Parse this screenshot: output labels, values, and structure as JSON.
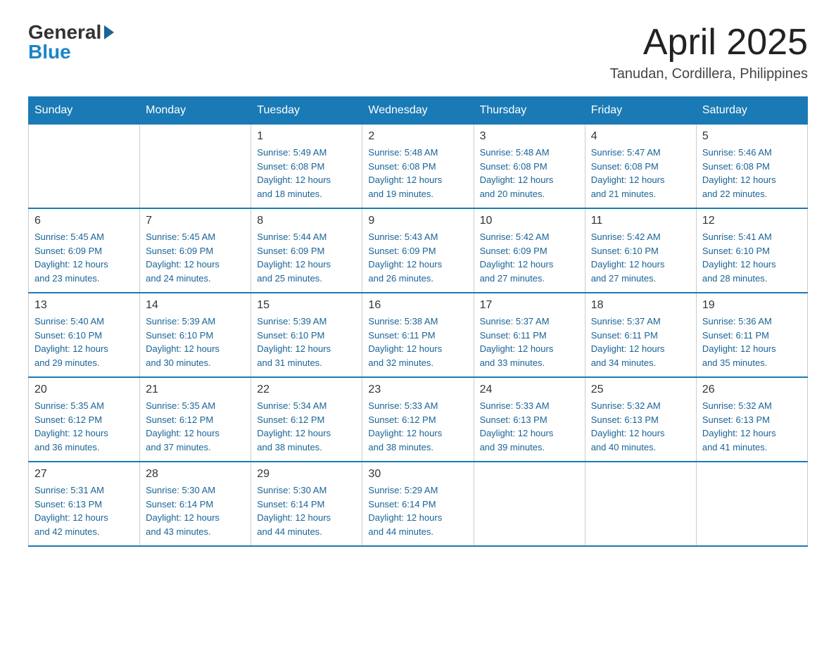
{
  "header": {
    "logo_general": "General",
    "logo_blue": "Blue",
    "month_title": "April 2025",
    "location": "Tanudan, Cordillera, Philippines"
  },
  "days_of_week": [
    "Sunday",
    "Monday",
    "Tuesday",
    "Wednesday",
    "Thursday",
    "Friday",
    "Saturday"
  ],
  "weeks": [
    [
      {
        "num": "",
        "info": ""
      },
      {
        "num": "",
        "info": ""
      },
      {
        "num": "1",
        "info": "Sunrise: 5:49 AM\nSunset: 6:08 PM\nDaylight: 12 hours\nand 18 minutes."
      },
      {
        "num": "2",
        "info": "Sunrise: 5:48 AM\nSunset: 6:08 PM\nDaylight: 12 hours\nand 19 minutes."
      },
      {
        "num": "3",
        "info": "Sunrise: 5:48 AM\nSunset: 6:08 PM\nDaylight: 12 hours\nand 20 minutes."
      },
      {
        "num": "4",
        "info": "Sunrise: 5:47 AM\nSunset: 6:08 PM\nDaylight: 12 hours\nand 21 minutes."
      },
      {
        "num": "5",
        "info": "Sunrise: 5:46 AM\nSunset: 6:08 PM\nDaylight: 12 hours\nand 22 minutes."
      }
    ],
    [
      {
        "num": "6",
        "info": "Sunrise: 5:45 AM\nSunset: 6:09 PM\nDaylight: 12 hours\nand 23 minutes."
      },
      {
        "num": "7",
        "info": "Sunrise: 5:45 AM\nSunset: 6:09 PM\nDaylight: 12 hours\nand 24 minutes."
      },
      {
        "num": "8",
        "info": "Sunrise: 5:44 AM\nSunset: 6:09 PM\nDaylight: 12 hours\nand 25 minutes."
      },
      {
        "num": "9",
        "info": "Sunrise: 5:43 AM\nSunset: 6:09 PM\nDaylight: 12 hours\nand 26 minutes."
      },
      {
        "num": "10",
        "info": "Sunrise: 5:42 AM\nSunset: 6:09 PM\nDaylight: 12 hours\nand 27 minutes."
      },
      {
        "num": "11",
        "info": "Sunrise: 5:42 AM\nSunset: 6:10 PM\nDaylight: 12 hours\nand 27 minutes."
      },
      {
        "num": "12",
        "info": "Sunrise: 5:41 AM\nSunset: 6:10 PM\nDaylight: 12 hours\nand 28 minutes."
      }
    ],
    [
      {
        "num": "13",
        "info": "Sunrise: 5:40 AM\nSunset: 6:10 PM\nDaylight: 12 hours\nand 29 minutes."
      },
      {
        "num": "14",
        "info": "Sunrise: 5:39 AM\nSunset: 6:10 PM\nDaylight: 12 hours\nand 30 minutes."
      },
      {
        "num": "15",
        "info": "Sunrise: 5:39 AM\nSunset: 6:10 PM\nDaylight: 12 hours\nand 31 minutes."
      },
      {
        "num": "16",
        "info": "Sunrise: 5:38 AM\nSunset: 6:11 PM\nDaylight: 12 hours\nand 32 minutes."
      },
      {
        "num": "17",
        "info": "Sunrise: 5:37 AM\nSunset: 6:11 PM\nDaylight: 12 hours\nand 33 minutes."
      },
      {
        "num": "18",
        "info": "Sunrise: 5:37 AM\nSunset: 6:11 PM\nDaylight: 12 hours\nand 34 minutes."
      },
      {
        "num": "19",
        "info": "Sunrise: 5:36 AM\nSunset: 6:11 PM\nDaylight: 12 hours\nand 35 minutes."
      }
    ],
    [
      {
        "num": "20",
        "info": "Sunrise: 5:35 AM\nSunset: 6:12 PM\nDaylight: 12 hours\nand 36 minutes."
      },
      {
        "num": "21",
        "info": "Sunrise: 5:35 AM\nSunset: 6:12 PM\nDaylight: 12 hours\nand 37 minutes."
      },
      {
        "num": "22",
        "info": "Sunrise: 5:34 AM\nSunset: 6:12 PM\nDaylight: 12 hours\nand 38 minutes."
      },
      {
        "num": "23",
        "info": "Sunrise: 5:33 AM\nSunset: 6:12 PM\nDaylight: 12 hours\nand 38 minutes."
      },
      {
        "num": "24",
        "info": "Sunrise: 5:33 AM\nSunset: 6:13 PM\nDaylight: 12 hours\nand 39 minutes."
      },
      {
        "num": "25",
        "info": "Sunrise: 5:32 AM\nSunset: 6:13 PM\nDaylight: 12 hours\nand 40 minutes."
      },
      {
        "num": "26",
        "info": "Sunrise: 5:32 AM\nSunset: 6:13 PM\nDaylight: 12 hours\nand 41 minutes."
      }
    ],
    [
      {
        "num": "27",
        "info": "Sunrise: 5:31 AM\nSunset: 6:13 PM\nDaylight: 12 hours\nand 42 minutes."
      },
      {
        "num": "28",
        "info": "Sunrise: 5:30 AM\nSunset: 6:14 PM\nDaylight: 12 hours\nand 43 minutes."
      },
      {
        "num": "29",
        "info": "Sunrise: 5:30 AM\nSunset: 6:14 PM\nDaylight: 12 hours\nand 44 minutes."
      },
      {
        "num": "30",
        "info": "Sunrise: 5:29 AM\nSunset: 6:14 PM\nDaylight: 12 hours\nand 44 minutes."
      },
      {
        "num": "",
        "info": ""
      },
      {
        "num": "",
        "info": ""
      },
      {
        "num": "",
        "info": ""
      }
    ]
  ]
}
